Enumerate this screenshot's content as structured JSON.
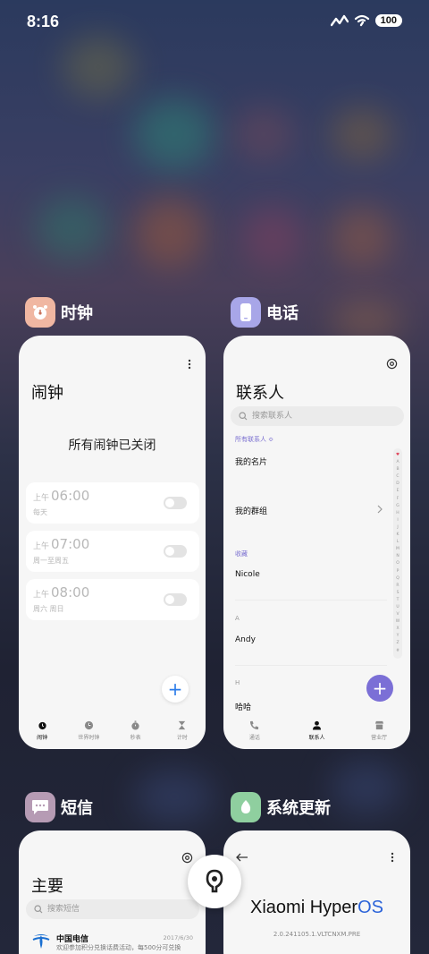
{
  "status_bar": {
    "time": "8:16",
    "battery": "100"
  },
  "recents": {
    "clock": {
      "app_name": "时钟",
      "title": "闹钟",
      "empty_text": "所有闹钟已关闭",
      "alarms": [
        {
          "ampm": "上午",
          "time": "06:00",
          "days": "每天",
          "enabled": false
        },
        {
          "ampm": "上午",
          "time": "07:00",
          "days": "周一至周五",
          "enabled": false
        },
        {
          "ampm": "上午",
          "time": "08:00",
          "days": "周六 周日",
          "enabled": false
        }
      ],
      "tabs": [
        "闹钟",
        "世界时钟",
        "秒表",
        "计时"
      ],
      "active_tab": 0
    },
    "phone": {
      "app_name": "电话",
      "title": "联系人",
      "search_placeholder": "搜索联系人",
      "all_contacts": "所有联系人 ≎",
      "my_card": "我的名片",
      "my_groups": "我的群组",
      "favorites_header": "收藏",
      "favorite_contact": "Nicole",
      "section_a": "A",
      "contact_a": "Andy",
      "section_h": "H",
      "contact_h": "哈哈",
      "alpha_index": [
        "♥",
        "A",
        "B",
        "C",
        "D",
        "E",
        "F",
        "G",
        "H",
        "I",
        "J",
        "K",
        "L",
        "M",
        "N",
        "O",
        "P",
        "Q",
        "R",
        "S",
        "T",
        "U",
        "V",
        "W",
        "X",
        "Y",
        "Z",
        "#"
      ],
      "tabs": [
        "通话",
        "联系人",
        "营业厅"
      ],
      "active_tab": 1
    },
    "sms": {
      "app_name": "短信",
      "title": "主要",
      "search_placeholder": "搜索短信",
      "first_item": {
        "sender": "中国电信",
        "date": "2017/6/30",
        "preview": "欢迎参加积分兑换话费活动，每500分可兑换"
      }
    },
    "updater": {
      "app_name": "系统更新",
      "brand": "Xiaomi Hyper",
      "brand_os": "OS",
      "version": "2.0.241105.1.VLTCNXM.PRE"
    }
  },
  "colors": {
    "accent": "#7b6fd6",
    "clock_fab": "#2b7ce9",
    "clock_icon_bg": "#f0b7a2",
    "phone_icon_bg": "#a8a6e8",
    "sms_icon_bg": "#b69bb4",
    "updater_icon_bg": "#8fcf9f"
  }
}
